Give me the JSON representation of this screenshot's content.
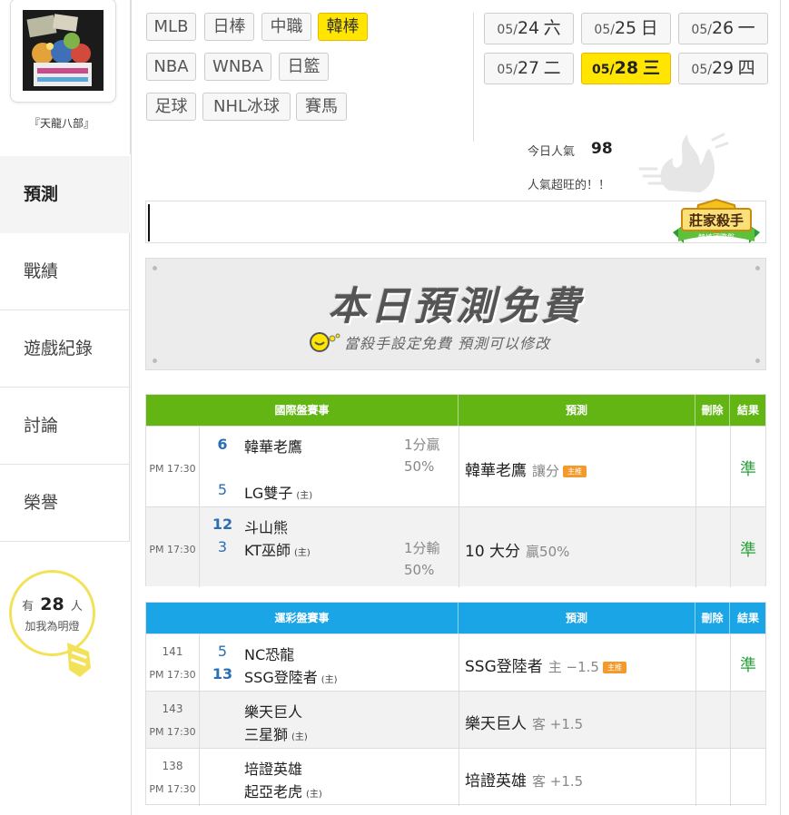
{
  "sidebar": {
    "user_name": "『天龍八部』",
    "items": [
      {
        "label": "預測",
        "active": true
      },
      {
        "label": "戰績",
        "active": false
      },
      {
        "label": "遊戲紀錄",
        "active": false
      },
      {
        "label": "討論",
        "active": false
      },
      {
        "label": "榮譽",
        "active": false
      }
    ],
    "light": {
      "prefix": "有",
      "count": "28",
      "suffix": "人",
      "sub": "加我為明燈"
    }
  },
  "sports": [
    {
      "label": "MLB",
      "active": false
    },
    {
      "label": "日棒",
      "active": false
    },
    {
      "label": "中職",
      "active": false
    },
    {
      "label": "韓棒",
      "active": true
    },
    {
      "label": "NBA",
      "active": false
    },
    {
      "label": "WNBA",
      "active": false
    },
    {
      "label": "日籃",
      "active": false
    },
    {
      "label": "足球",
      "active": false
    },
    {
      "label": "NHL冰球",
      "active": false
    },
    {
      "label": "賽馬",
      "active": false
    }
  ],
  "dates": [
    {
      "month": "05/",
      "day": "24",
      "weekday": "六",
      "active": false
    },
    {
      "month": "05/",
      "day": "25",
      "weekday": "日",
      "active": false
    },
    {
      "month": "05/",
      "day": "26",
      "weekday": "一",
      "active": false
    },
    {
      "month": "05/",
      "day": "27",
      "weekday": "二",
      "active": false
    },
    {
      "month": "05/",
      "day": "28",
      "weekday": "三",
      "active": true
    },
    {
      "month": "05/",
      "day": "29",
      "weekday": "四",
      "active": false
    }
  ],
  "popularity": {
    "label": "今日人氣",
    "value": "98",
    "status": "人氣超旺的！！"
  },
  "badge": {
    "title": "莊家殺手",
    "sub": "韓棒國際盤"
  },
  "free_banner": {
    "title": "本日預測免費",
    "sub": "當殺手設定免費 預測可以修改"
  },
  "intl_table": {
    "headers": {
      "event": "國際盤賽事",
      "pick": "預測",
      "delete": "刪除",
      "result": "結果"
    },
    "rows": [
      {
        "time": "PM 17:30",
        "away_score": "6",
        "away": "韓華老鷹",
        "home_score": "5",
        "home": "LG雙子",
        "home_mark": "(主)",
        "line_a": "1分贏",
        "line_b": "50%",
        "pick": "韓華老鷹",
        "pick_sub": "讓分",
        "tag": "主推",
        "result": "準"
      },
      {
        "time": "PM 17:30",
        "away_score": "12",
        "away": "斗山熊",
        "home_score": "3",
        "home": "KT巫師",
        "home_mark": "(主)",
        "line_a": "1分輸",
        "line_b": "50%",
        "pick": "10 大分",
        "pick_sub": "贏50%",
        "result": "準"
      }
    ]
  },
  "lottery_table": {
    "headers": {
      "event": "運彩盤賽事",
      "pick": "預測",
      "delete": "刪除",
      "result": "結果"
    },
    "rows": [
      {
        "no": "141",
        "time": "PM 17:30",
        "away_score": "5",
        "away": "NC恐龍",
        "home_score": "13",
        "home": "SSG登陸者",
        "home_mark": "(主)",
        "pick": "SSG登陸者",
        "pick_sub": "主 −1.5",
        "tag": "主推",
        "result": "準"
      },
      {
        "no": "143",
        "time": "PM 17:30",
        "away": "樂天巨人",
        "home": "三星獅",
        "home_mark": "(主)",
        "pick": "樂天巨人",
        "pick_sub": "客 +1.5",
        "result": ""
      },
      {
        "no": "138",
        "time": "PM 17:30",
        "away": "培證英雄",
        "home": "起亞老虎",
        "home_mark": "(主)",
        "pick": "培證英雄",
        "pick_sub": "客 +1.5",
        "result": ""
      }
    ]
  },
  "colors": {
    "accent_yellow": "#ffe500",
    "intl_header": "#63b514",
    "lottery_header": "#1aa6e6",
    "result_green": "#2aa33a",
    "score_blue": "#2a6fb5"
  }
}
